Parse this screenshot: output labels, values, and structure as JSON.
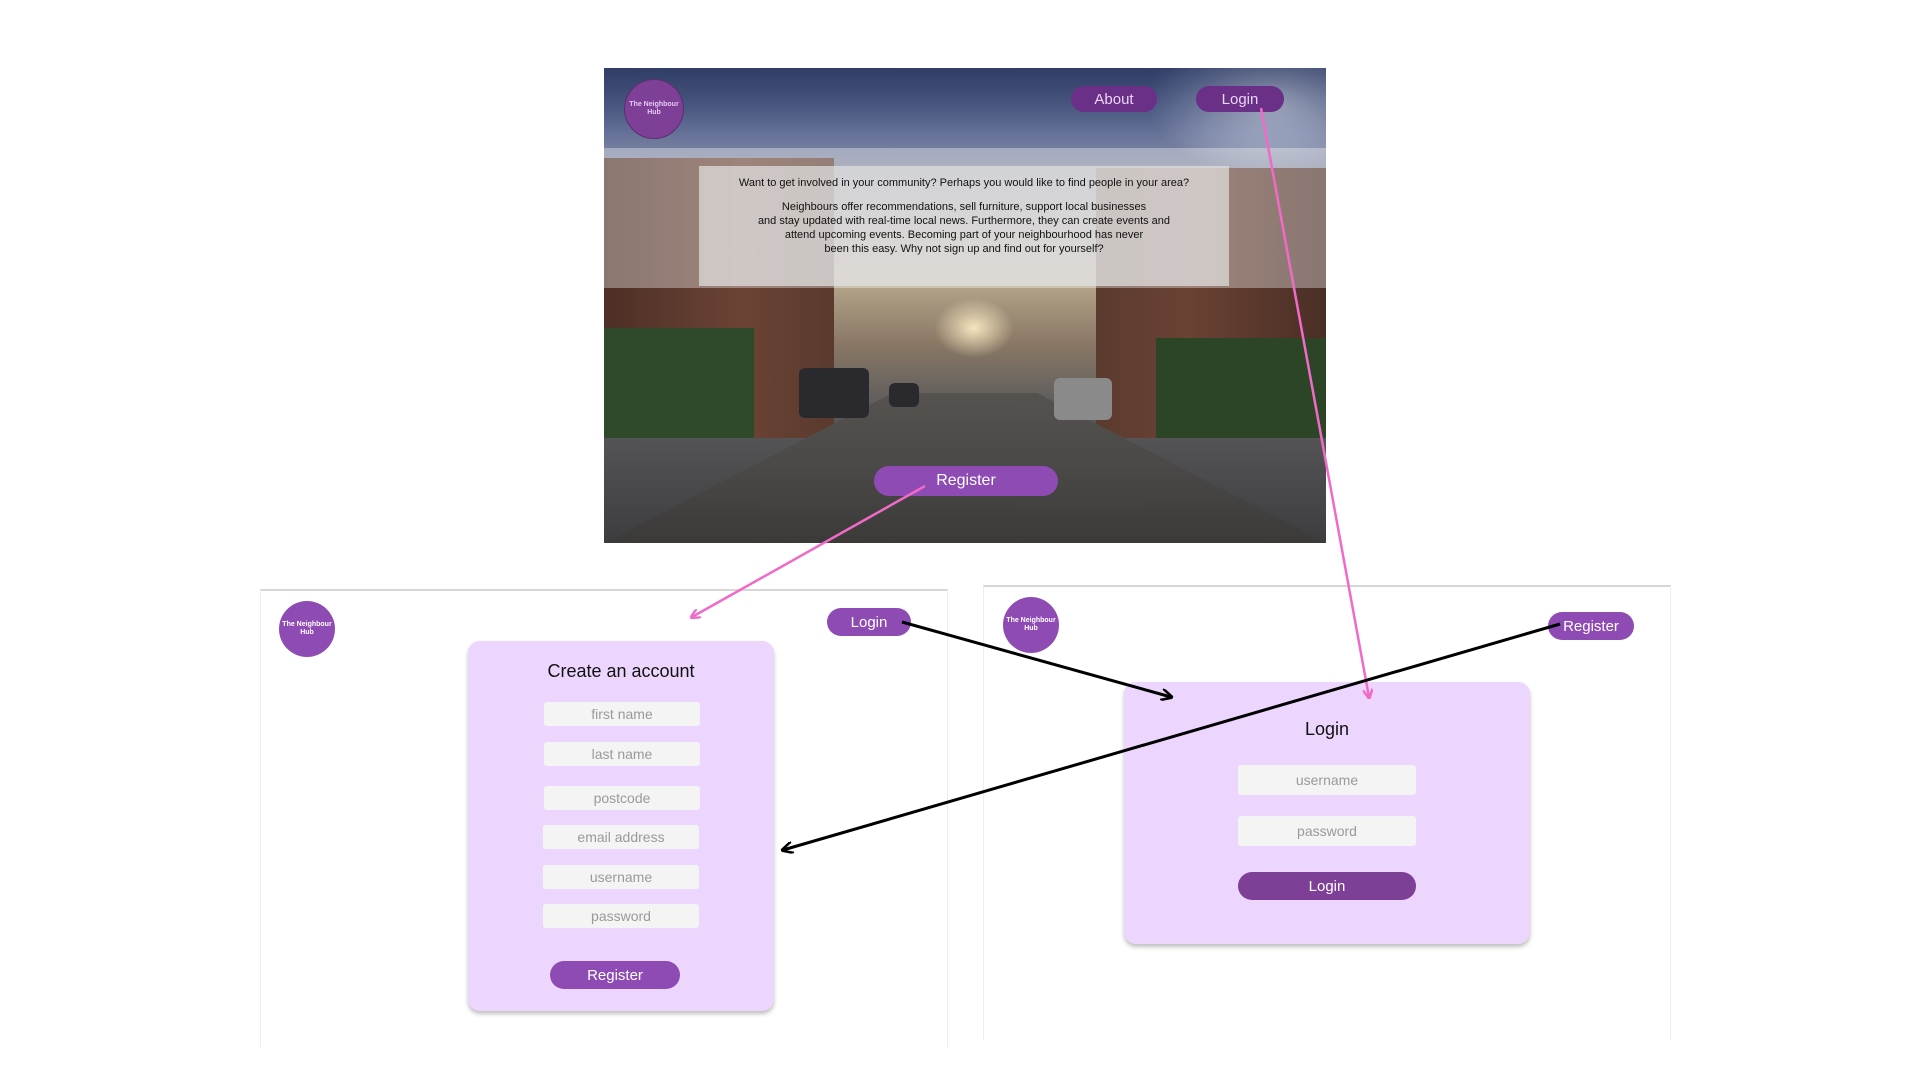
{
  "brand": {
    "logo_text": "The Neighbour Hub"
  },
  "home": {
    "nav": {
      "about": "About",
      "login": "Login"
    },
    "intro_question": "Want to get involved in your community? Perhaps you would like to find people in your area?",
    "intro_body": "Neighbours offer recommendations, sell furniture, support local businesses\nand stay updated with real-time local news. Furthermore, they can create events and\nattend upcoming events. Becoming part of your neighbourhood has never\nbeen this easy. Why not sign up and find out for yourself?",
    "register_button": "Register"
  },
  "register_page": {
    "top_login": "Login",
    "title": "Create an account",
    "fields": {
      "first_name": "first name",
      "last_name": "last name",
      "postcode": "postcode",
      "email": "email address",
      "username": "username",
      "password": "password"
    },
    "submit": "Register"
  },
  "login_page": {
    "top_register": "Register",
    "title": "Login",
    "fields": {
      "username": "username",
      "password": "password"
    },
    "submit": "Login"
  },
  "colors": {
    "brand_purple": "#8e4bb4",
    "dark_purple": "#6a2f86",
    "card_lilac": "#edd6fd",
    "arrow_pink": "#f06bc8",
    "arrow_black": "#000000"
  }
}
